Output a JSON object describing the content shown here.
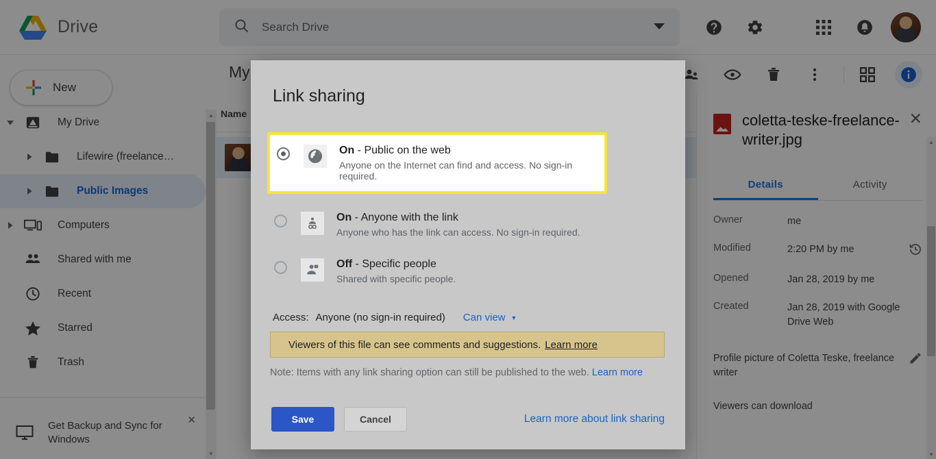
{
  "app": {
    "brand": "Drive",
    "logo_colors": {
      "blue": "#4285f4",
      "green": "#0f9d58",
      "yellow": "#f4b400"
    }
  },
  "search": {
    "placeholder": "Search Drive",
    "value": "",
    "icon": "search-icon",
    "caret_icon": "chevron-down-icon"
  },
  "topbar_icons": [
    {
      "name": "help-icon",
      "glyph": "?"
    },
    {
      "name": "gear-icon",
      "glyph": "gear"
    },
    {
      "name": "apps-grid-icon",
      "glyph": "grid"
    },
    {
      "name": "bell-icon",
      "glyph": "bell"
    }
  ],
  "toolbar": {
    "items": [
      {
        "name": "share-person-icon",
        "label": "Share"
      },
      {
        "name": "eye-preview-icon",
        "label": "Preview"
      },
      {
        "name": "trash-icon",
        "label": "Remove"
      },
      {
        "name": "more-vertical-icon",
        "label": "More actions"
      },
      {
        "name": "grid-view-icon",
        "label": "Grid view"
      },
      {
        "name": "info-icon",
        "label": "View details"
      }
    ],
    "info_active_color": "#1a73e8"
  },
  "sidebar": {
    "new_button": "New",
    "items": [
      {
        "label": "My Drive",
        "icon": "drive-icon",
        "expandable": true,
        "expanded": true,
        "indent": 0,
        "selected": false
      },
      {
        "label": "Lifewire (freelance…",
        "icon": "folder-icon",
        "expandable": true,
        "expanded": false,
        "indent": 1,
        "selected": false
      },
      {
        "label": "Public Images",
        "icon": "folder-icon",
        "expandable": true,
        "expanded": false,
        "indent": 1,
        "selected": true
      },
      {
        "label": "Computers",
        "icon": "computer-icon",
        "expandable": true,
        "expanded": false,
        "indent": 0,
        "selected": false
      },
      {
        "label": "Shared with me",
        "icon": "people-icon",
        "expandable": false,
        "expanded": false,
        "indent": 0,
        "selected": false
      },
      {
        "label": "Recent",
        "icon": "clock-icon",
        "expandable": false,
        "expanded": false,
        "indent": 0,
        "selected": false
      },
      {
        "label": "Starred",
        "icon": "star-icon",
        "expandable": false,
        "expanded": false,
        "indent": 0,
        "selected": false
      },
      {
        "label": "Trash",
        "icon": "trash-icon",
        "expandable": false,
        "expanded": false,
        "indent": 0,
        "selected": false
      }
    ],
    "promo": {
      "label": "Get Backup and Sync for Windows",
      "icon": "monitor-icon",
      "close_icon": "close-icon"
    }
  },
  "main": {
    "title": "My Drive",
    "column_header": "Name",
    "row": {
      "thumbnail": "photo-thumbnail"
    }
  },
  "details": {
    "file_name": "coletta-teske-freelance-writer.jpg",
    "file_type_icon": "image-file-icon",
    "close_icon": "close-icon",
    "tabs": [
      {
        "label": "Details",
        "active": true
      },
      {
        "label": "Activity",
        "active": false
      }
    ],
    "meta": [
      {
        "key": "Owner",
        "value": "me",
        "icon": null
      },
      {
        "key": "Modified",
        "value": "2:20 PM by me",
        "icon": "history-icon"
      },
      {
        "key": "Opened",
        "value": "Jan 28, 2019 by me",
        "icon": null
      },
      {
        "key": "Created",
        "value": "Jan 28, 2019 with Google Drive Web",
        "icon": null
      }
    ],
    "description": "Profile picture of Coletta Teske, freelance writer",
    "description_edit_icon": "pencil-icon",
    "footer_item": "Viewers can download"
  },
  "dialog": {
    "title": "Link sharing",
    "options": [
      {
        "state_label": "On",
        "dash": " - ",
        "title": "Public on the web",
        "subtitle": "Anyone on the Internet can find and access. No sign-in required.",
        "icon": "globe-icon",
        "selected": true,
        "highlighted": true
      },
      {
        "state_label": "On",
        "dash": " - ",
        "title": "Anyone with the link",
        "subtitle": "Anyone who has the link can access. No sign-in required.",
        "icon": "person-link-icon",
        "selected": false,
        "highlighted": false
      },
      {
        "state_label": "Off",
        "dash": " - ",
        "title": "Specific people",
        "subtitle": "Shared with specific people.",
        "icon": "person-lock-icon",
        "selected": false,
        "highlighted": false
      }
    ],
    "access": {
      "label": "Access:",
      "value": "Anyone (no sign-in required)",
      "permission": "Can view",
      "caret_icon": "chevron-down-icon"
    },
    "warning": {
      "text": "Viewers of this file can see comments and suggestions.",
      "link": "Learn more"
    },
    "note": {
      "text": "Note: Items with any link sharing option can still be published to the web.",
      "link": "Learn more"
    },
    "save_label": "Save",
    "cancel_label": "Cancel",
    "learn_more_label": "Learn more about link sharing",
    "highlight_color": "#f5e63a",
    "save_color": "#2a56c6",
    "link_color": "#1a62c4"
  }
}
